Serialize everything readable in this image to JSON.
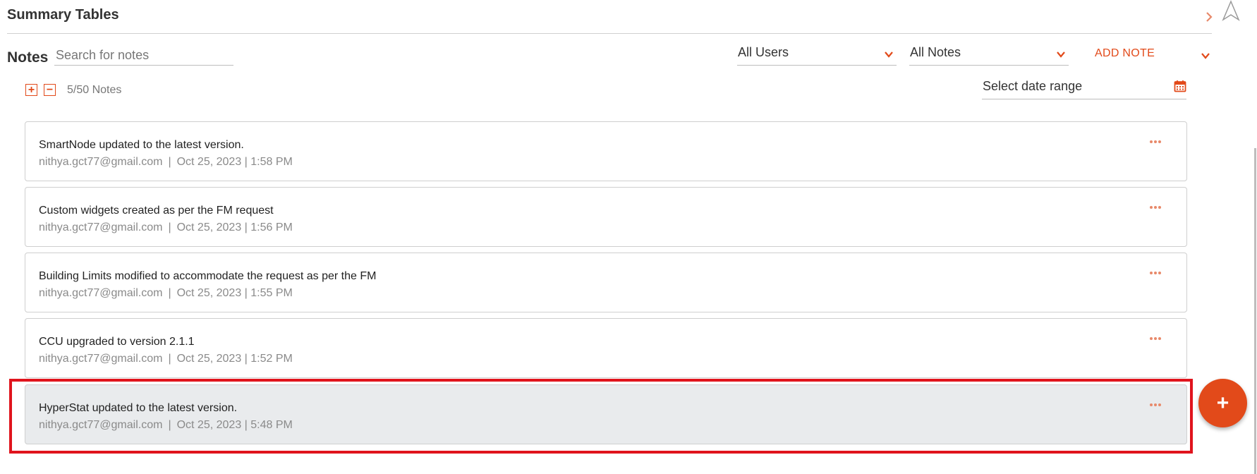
{
  "header": {
    "title": "Summary Tables",
    "chevron_icon": "chevron-right-icon",
    "nav_icon": "navigation-arrow-icon"
  },
  "notes": {
    "label": "Notes",
    "search_placeholder": "Search for notes",
    "users_filter": "All Users",
    "notes_filter": "All Notes",
    "add_note_label": "ADD NOTE",
    "expand_symbol": "+",
    "collapse_symbol": "−",
    "count_label": "5/50 Notes",
    "date_range_label": "Select date range",
    "accent_color": "#e24a1a",
    "items": [
      {
        "title": "SmartNode updated to the latest version.",
        "email": "nithya.gct77@gmail.com",
        "timestamp": "Oct 25, 2023 | 1:58 PM"
      },
      {
        "title": "Custom widgets created as per the FM request",
        "email": "nithya.gct77@gmail.com",
        "timestamp": "Oct 25, 2023 | 1:56 PM"
      },
      {
        "title": "Building Limits modified to accommodate the request as per the FM",
        "email": "nithya.gct77@gmail.com",
        "timestamp": "Oct 25, 2023 | 1:55 PM"
      },
      {
        "title": "CCU upgraded to version 2.1.1",
        "email": "nithya.gct77@gmail.com",
        "timestamp": "Oct 25, 2023 | 1:52 PM"
      },
      {
        "title": "HyperStat updated to the latest version.",
        "email": "nithya.gct77@gmail.com",
        "timestamp": "Oct 25, 2023 | 5:48 PM"
      }
    ]
  },
  "fab": {
    "symbol": "+"
  },
  "meta_separator": "|"
}
